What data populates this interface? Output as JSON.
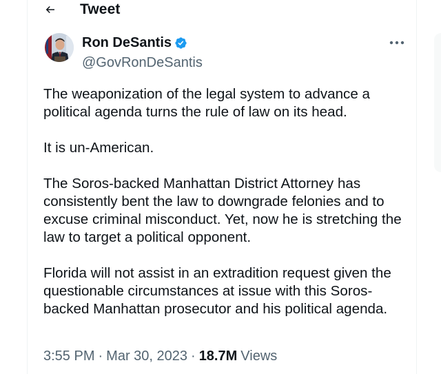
{
  "header": {
    "title": "Tweet",
    "back_icon": "arrow-left-icon"
  },
  "author": {
    "display_name": "Ron DeSantis",
    "handle": "@GovRonDeSantis",
    "verified_icon": "verified-badge-icon",
    "verified_color": "#1d9bf0"
  },
  "more_icon": "more-horizontal-icon",
  "tweet": {
    "paragraphs": [
      "The weaponization of the legal system to advance a political agenda turns the rule of law on its head.",
      "It is un-American.",
      "The Soros-backed Manhattan District Attorney has consistently bent the law to downgrade felonies and to excuse criminal misconduct. Yet, now he is stretching the law to target a political opponent.",
      "Florida will not assist in an extradition request given the questionable circumstances at issue with this Soros-backed Manhattan prosecutor and his political agenda."
    ]
  },
  "meta": {
    "time": "3:55 PM",
    "separator": "·",
    "date": "Mar 30, 2023",
    "views_count": "18.7M",
    "views_label": "Views"
  }
}
